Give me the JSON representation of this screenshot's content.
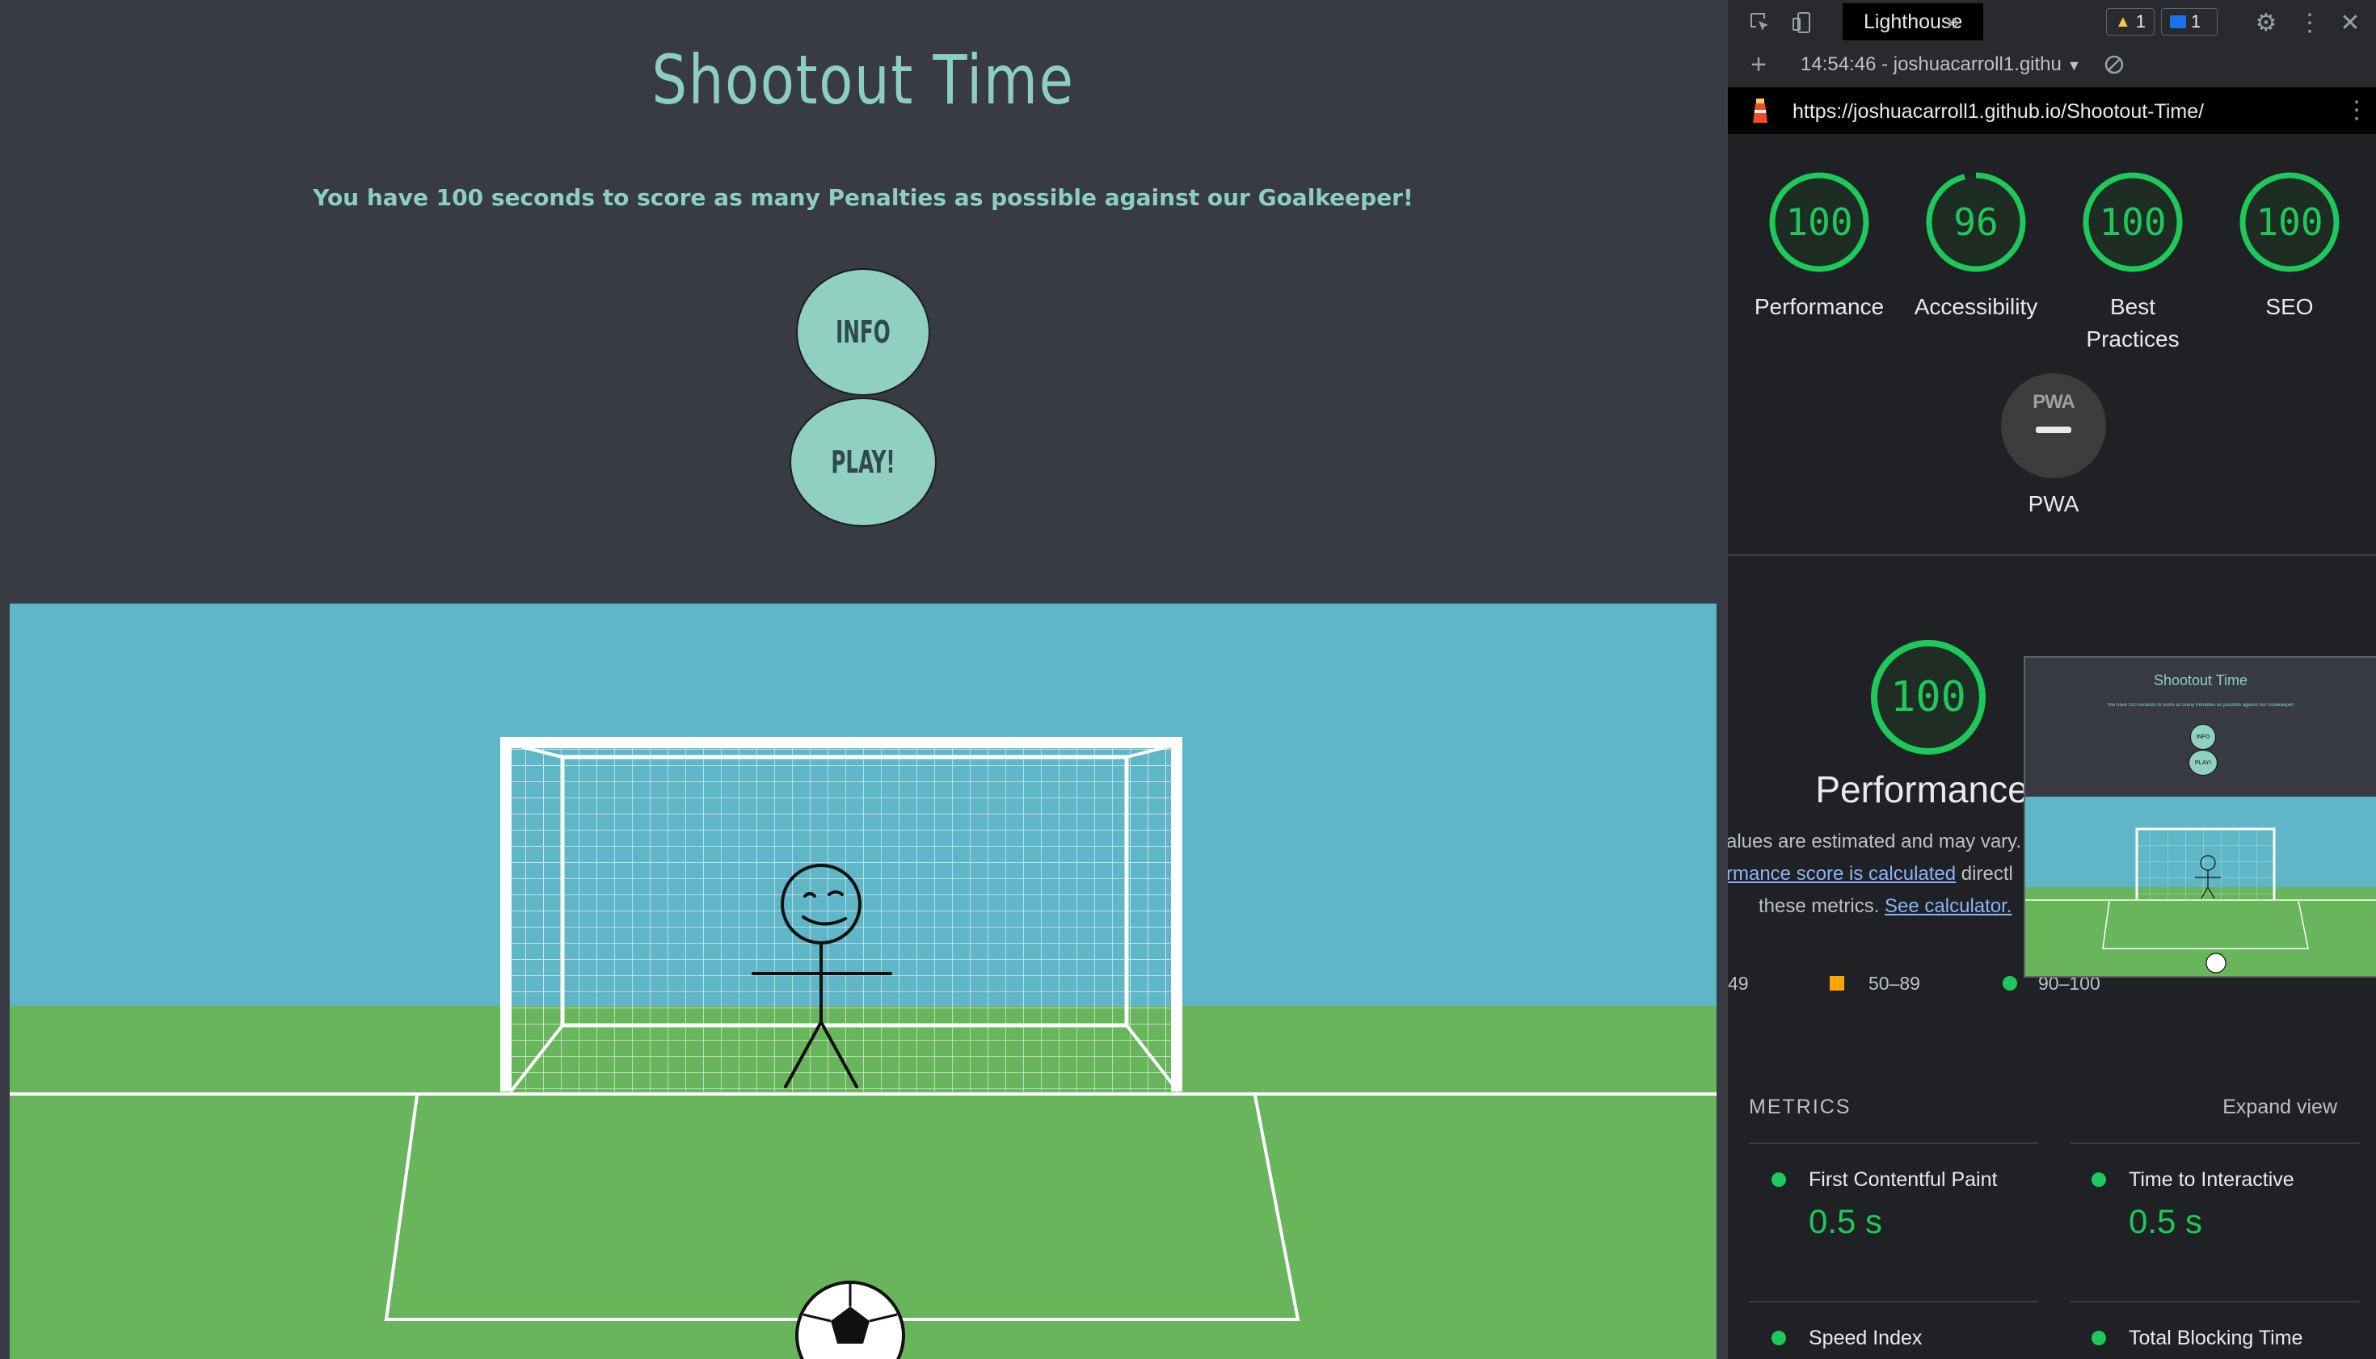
{
  "game": {
    "title": "Shootout  Time",
    "subtitle": "You have 100 seconds to score as many Penalties as possible against our Goalkeeper!",
    "info_label": "INFO",
    "play_label": "PLAY!",
    "colors": {
      "background": "#383b44",
      "accent": "#8ccfc0",
      "sky": "#5fb6c6",
      "grass": "#68b55b"
    }
  },
  "devtools": {
    "tabs": {
      "active": "Lighthouse",
      "more": "»"
    },
    "warnings_count": "1",
    "messages_count": "1",
    "report_selector": "14:54:46 - joshuacarroll1.githu",
    "url": "https://joshuacarroll1.github.io/Shootout-Time/",
    "scores": [
      {
        "score": 100,
        "label": "Performance"
      },
      {
        "score": 96,
        "label": "Accessibility"
      },
      {
        "score": 100,
        "label": "Best Practices"
      },
      {
        "score": 100,
        "label": "SEO"
      }
    ],
    "pwa": {
      "badge": "PWA",
      "label": "PWA"
    },
    "performance": {
      "score": 100,
      "title": "Performance",
      "desc_line1": "alues are estimated and may vary. T",
      "desc_link1": "rmance score is calculated",
      "desc_after_link1": " directl",
      "desc_line3_pre": "these metrics. ",
      "desc_link2": "See calculator.",
      "legend": [
        "49",
        "50–89",
        "90–100"
      ]
    },
    "thumbnail": {
      "title": "Shootout  Time",
      "subtitle": "You have 100 seconds to score as many Penalties as possible against our Goalkeeper!",
      "info_label": "INFO",
      "play_label": "PLAY!"
    },
    "metrics": {
      "heading": "METRICS",
      "expand": "Expand view",
      "items": [
        {
          "name": "First Contentful Paint",
          "value": "0.5 s"
        },
        {
          "name": "Time to Interactive",
          "value": "0.5 s"
        },
        {
          "name": "Speed Index",
          "value": ""
        },
        {
          "name": "Total Blocking Time",
          "value": ""
        }
      ]
    },
    "colors": {
      "pass": "#1ec95b",
      "average": "#ffa400",
      "link": "#8ab4f8"
    }
  }
}
